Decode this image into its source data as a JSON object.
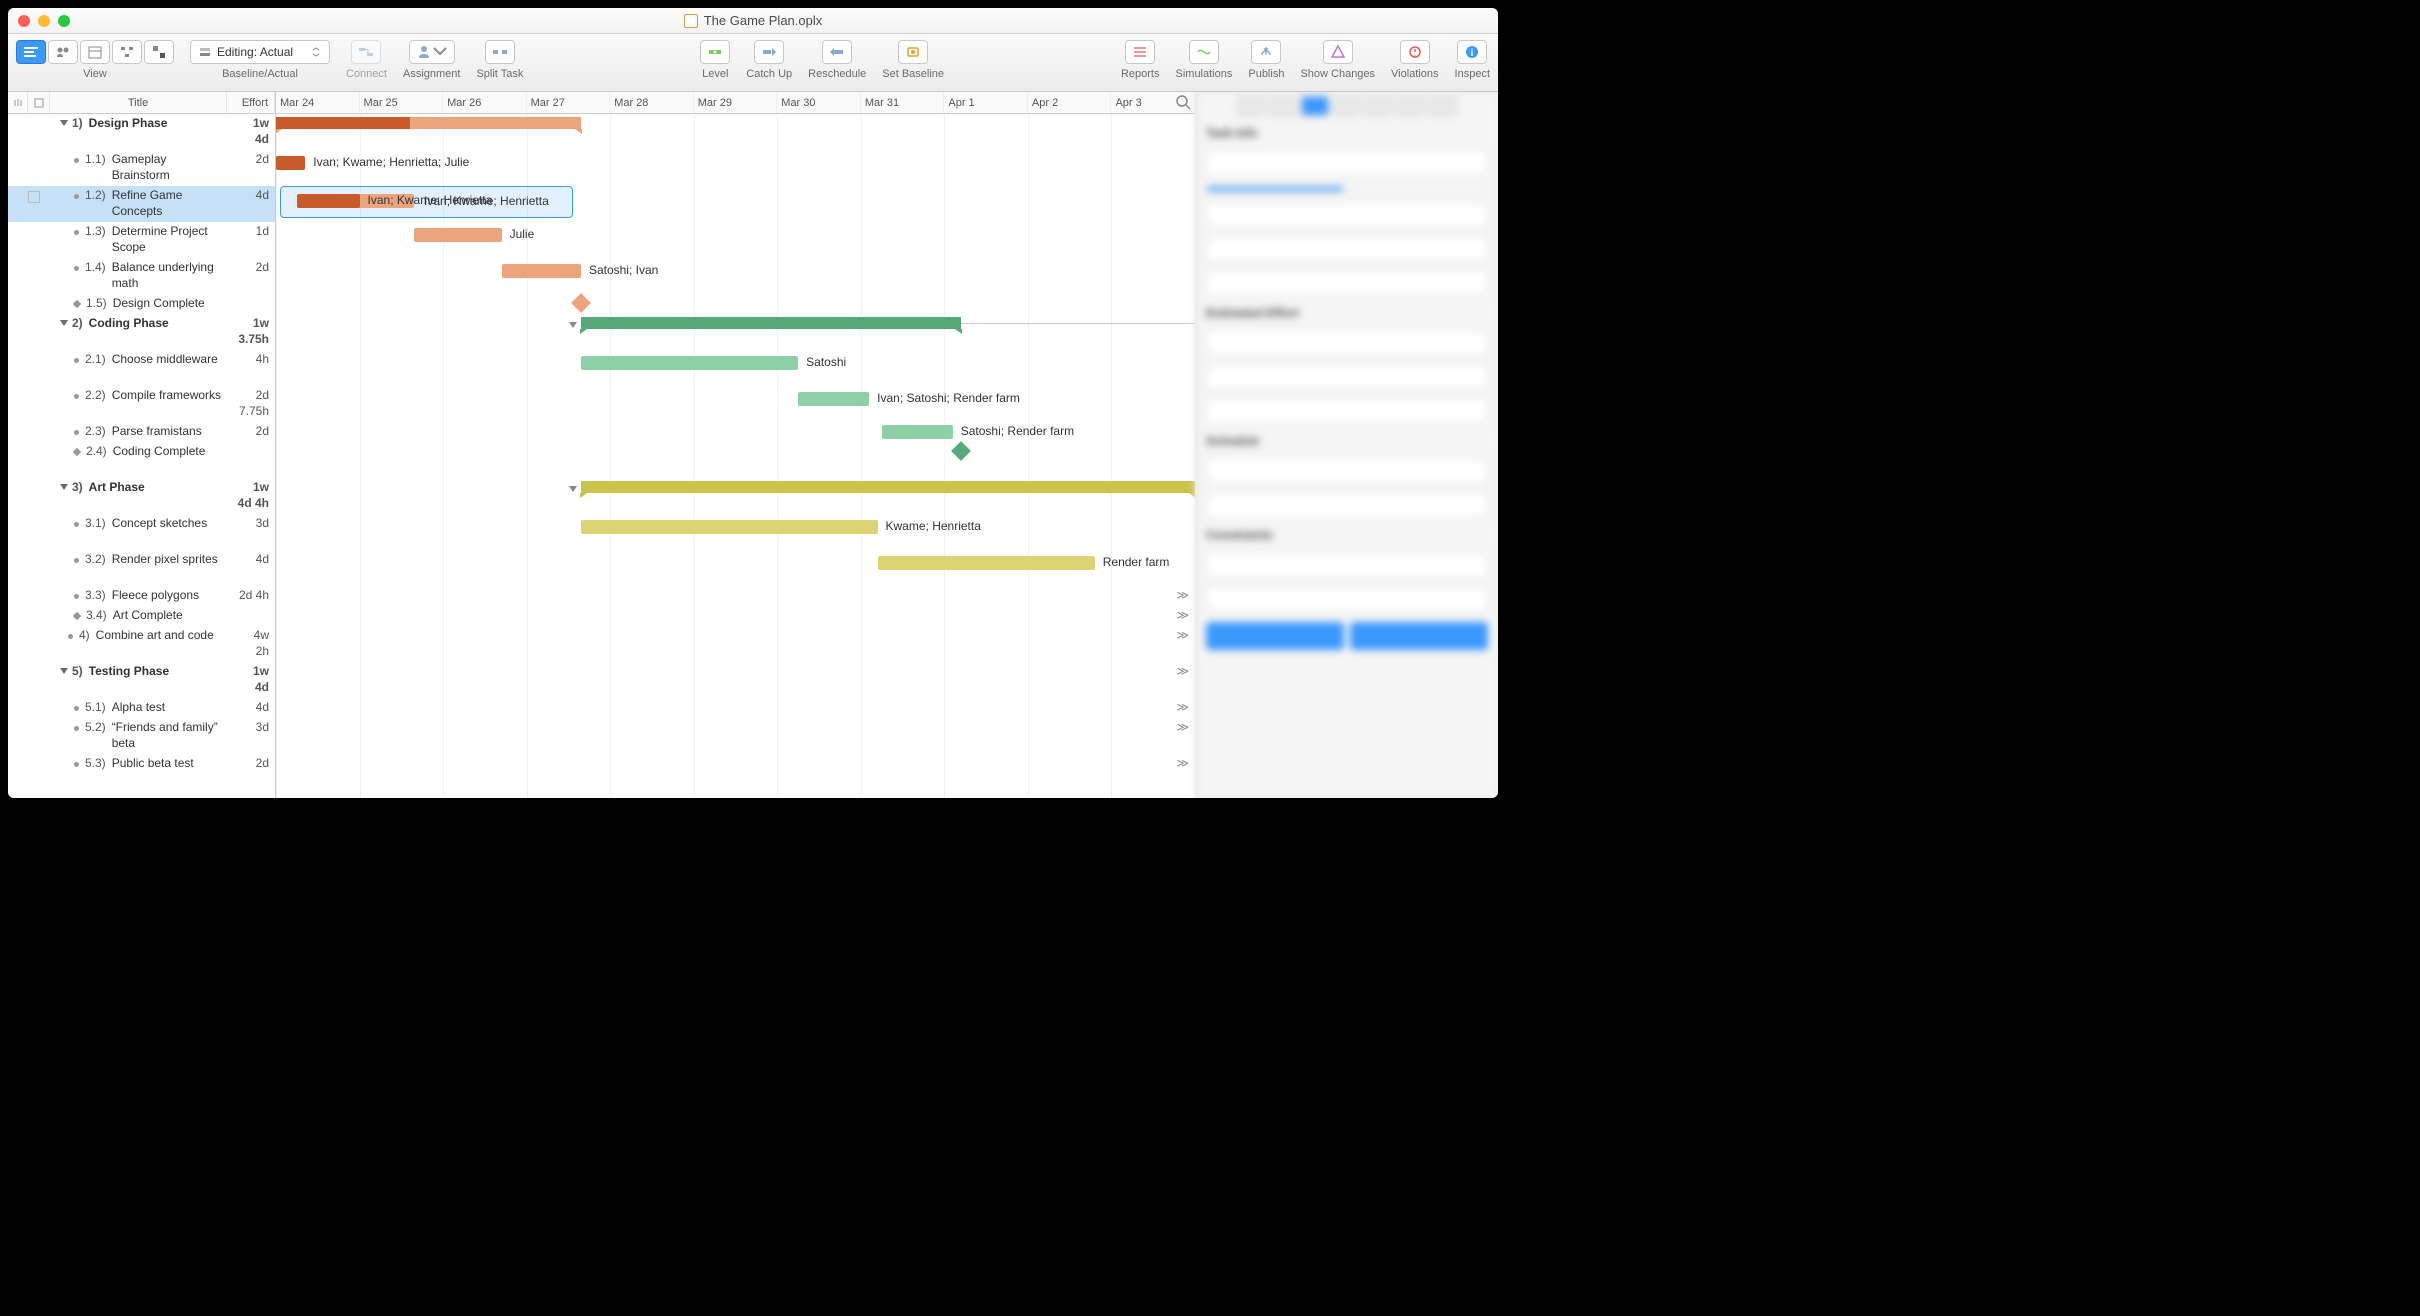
{
  "window": {
    "title": "The Game Plan.oplx"
  },
  "toolbar": {
    "view_label": "View",
    "baseline_label": "Baseline/Actual",
    "baseline_value": "Editing: Actual",
    "connect": "Connect",
    "assignment": "Assignment",
    "split_task": "Split Task",
    "level": "Level",
    "catch_up": "Catch Up",
    "reschedule": "Reschedule",
    "set_baseline": "Set Baseline",
    "reports": "Reports",
    "simulations": "Simulations",
    "publish": "Publish",
    "show_changes": "Show Changes",
    "violations": "Violations",
    "inspect": "Inspect"
  },
  "outline_headers": {
    "title": "Title",
    "effort": "Effort"
  },
  "dates": [
    "Mar 24",
    "Mar 25",
    "Mar 26",
    "Mar 27",
    "Mar 28",
    "Mar 29",
    "Mar 30",
    "Mar 31",
    "Apr 1",
    "Apr 2",
    "Apr 3"
  ],
  "rows": [
    {
      "id": "r1",
      "type": "phase",
      "num": "1)",
      "title": "Design Phase",
      "effort": "1w",
      "effort2": "4d"
    },
    {
      "id": "r2",
      "type": "task",
      "num": "1.1)",
      "title": "Gameplay Brainstorm",
      "effort": "2d",
      "label": "Ivan; Kwame; Henrietta; Julie"
    },
    {
      "id": "r3",
      "type": "task",
      "num": "1.2)",
      "title": "Refine Game Concepts",
      "effort": "4d",
      "label": "Ivan; Kwame; Henrietta",
      "selected": true,
      "note": true
    },
    {
      "id": "r4",
      "type": "task",
      "num": "1.3)",
      "title": "Determine Project Scope",
      "effort": "1d",
      "label": "Julie"
    },
    {
      "id": "r5",
      "type": "task",
      "num": "1.4)",
      "title": "Balance underlying math",
      "effort": "2d",
      "label": "Satoshi; Ivan"
    },
    {
      "id": "r6",
      "type": "milestone",
      "num": "1.5)",
      "title": "Design Complete",
      "effort": ""
    },
    {
      "id": "r7",
      "type": "phase",
      "num": "2)",
      "title": "Coding Phase",
      "effort": "1w",
      "effort2": "3.75h"
    },
    {
      "id": "r8",
      "type": "task",
      "num": "2.1)",
      "title": "Choose middleware",
      "effort": "4h",
      "label": "Satoshi"
    },
    {
      "id": "r9",
      "type": "task",
      "num": "2.2)",
      "title": "Compile frameworks",
      "effort": "2d",
      "effort2": "7.75h",
      "label": "Ivan; Satoshi; Render farm"
    },
    {
      "id": "r10",
      "type": "task",
      "num": "2.3)",
      "title": "Parse framistans",
      "effort": "2d",
      "label": "Satoshi; Render farm"
    },
    {
      "id": "r11",
      "type": "milestone",
      "num": "2.4)",
      "title": "Coding Complete",
      "effort": ""
    },
    {
      "id": "r12",
      "type": "phase",
      "num": "3)",
      "title": "Art Phase",
      "effort": "1w",
      "effort2": "4d 4h"
    },
    {
      "id": "r13",
      "type": "task",
      "num": "3.1)",
      "title": "Concept sketches",
      "effort": "3d",
      "label": "Kwame; Henrietta"
    },
    {
      "id": "r14",
      "type": "task",
      "num": "3.2)",
      "title": "Render pixel sprites",
      "effort": "4d",
      "label": "Render farm"
    },
    {
      "id": "r15",
      "type": "task",
      "num": "3.3)",
      "title": "Fleece polygons",
      "effort": "2d 4h"
    },
    {
      "id": "r16",
      "type": "milestone",
      "num": "3.4)",
      "title": "Art Complete",
      "effort": ""
    },
    {
      "id": "r17",
      "type": "task-top",
      "num": "4)",
      "title": "Combine art and code",
      "effort": "4w",
      "effort2": "2h"
    },
    {
      "id": "r18",
      "type": "phase",
      "num": "5)",
      "title": "Testing Phase",
      "effort": "1w",
      "effort2": "4d"
    },
    {
      "id": "r19",
      "type": "task",
      "num": "5.1)",
      "title": "Alpha test",
      "effort": "4d"
    },
    {
      "id": "r20",
      "type": "task",
      "num": "5.2)",
      "title": "“Friends and family” beta",
      "effort": "3d"
    },
    {
      "id": "r21",
      "type": "task",
      "num": "5.3)",
      "title": "Public beta test",
      "effort": "2d"
    }
  ],
  "colors": {
    "orange_dark": "#c95a29",
    "orange": "#eba47c",
    "green_dark": "#58a97a",
    "green": "#8dd0a8",
    "olive": "#cbc34a",
    "olive_light": "#dcd473",
    "blue_sel": "#3b99fc"
  }
}
